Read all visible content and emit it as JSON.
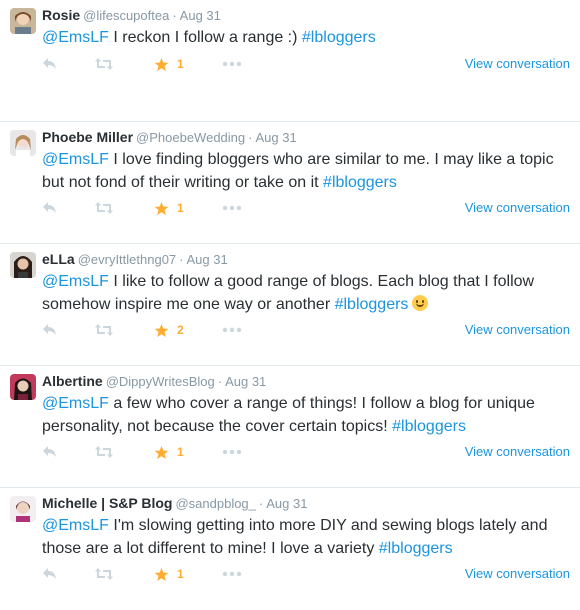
{
  "colors": {
    "link": "#1b95e0",
    "favorite": "#ffac33",
    "muted": "#8899a6",
    "icon": "#ccd6dd"
  },
  "icons": {
    "reply": "reply-icon",
    "retweet": "retweet-icon",
    "favorite": "star-icon",
    "more": "more-dots-icon"
  },
  "tweets": [
    {
      "name": "Rosie",
      "handle": "@lifescupoftea",
      "dot": "·",
      "time": "Aug 31",
      "mention": "@EmsLF",
      "body": " I reckon I follow a range :) ",
      "hashtag": "#lbloggers",
      "favorites": "1",
      "view": "View conversation"
    },
    {
      "name": "Phoebe Miller",
      "handle": "@PhoebeWedding",
      "dot": "·",
      "time": "Aug 31",
      "mention": "@EmsLF",
      "body": " I love finding bloggers who are similar to me. I may like a topic but not fond of their writing or take on it ",
      "hashtag": "#lbloggers",
      "favorites": "1",
      "view": "View conversation"
    },
    {
      "name": "eLLa",
      "handle": "@evryIttlethng07",
      "dot": "·",
      "time": "Aug 31",
      "mention": "@EmsLF",
      "body": " I like to follow a good range of blogs. Each blog that I follow somehow inspire me one way or another ",
      "hashtag": "#lbloggers",
      "favorites": "2",
      "view": "View conversation"
    },
    {
      "name": "Albertine",
      "handle": "@DippyWritesBlog",
      "dot": "·",
      "time": "Aug 31",
      "mention": "@EmsLF",
      "body": " a few who cover a range of things! I follow a blog for unique personality, not because the cover certain topics! ",
      "hashtag": "#lbloggers",
      "favorites": "1",
      "view": "View conversation"
    },
    {
      "name": "Michelle | S&P Blog",
      "handle": "@sandpblog_",
      "dot": "·",
      "time": "Aug 31",
      "mention": "@EmsLF",
      "body": " I'm slowing getting into more DIY and sewing blogs lately and those are a lot different to mine! I love a variety ",
      "hashtag": "#lbloggers",
      "favorites": "1",
      "view": "View conversation"
    }
  ]
}
